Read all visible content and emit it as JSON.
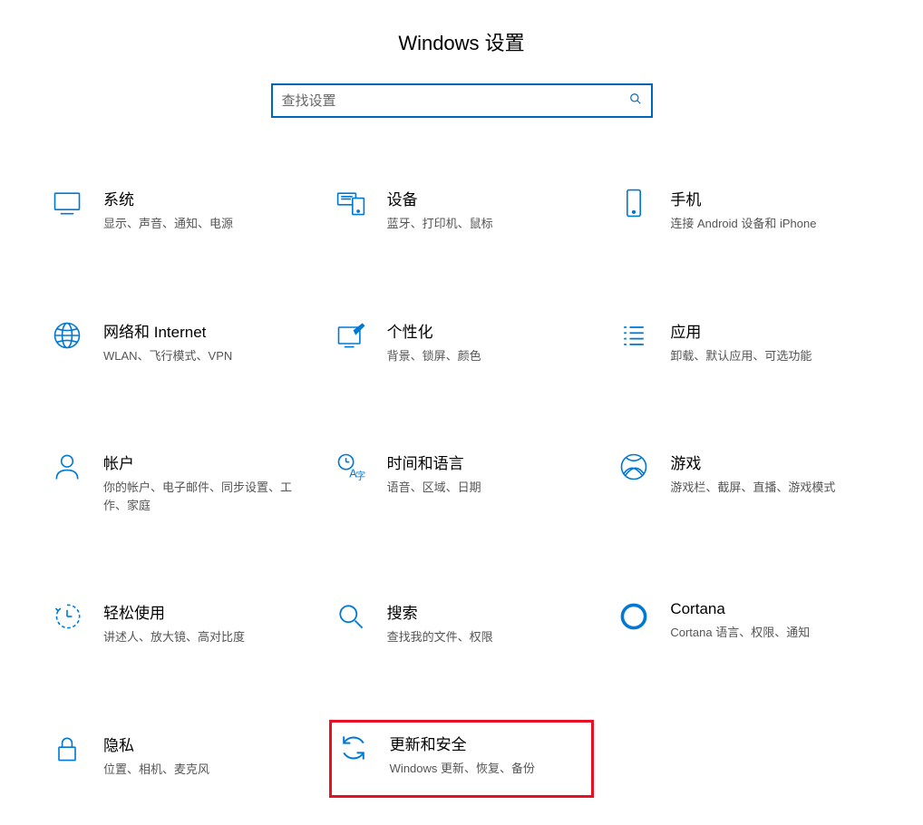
{
  "header": {
    "title": "Windows 设置"
  },
  "search": {
    "placeholder": "查找设置"
  },
  "tiles": {
    "system": {
      "title": "系统",
      "desc": "显示、声音、通知、电源"
    },
    "devices": {
      "title": "设备",
      "desc": "蓝牙、打印机、鼠标"
    },
    "phone": {
      "title": "手机",
      "desc": "连接 Android 设备和 iPhone"
    },
    "network": {
      "title": "网络和 Internet",
      "desc": "WLAN、飞行模式、VPN"
    },
    "personalization": {
      "title": "个性化",
      "desc": "背景、锁屏、颜色"
    },
    "apps": {
      "title": "应用",
      "desc": "卸载、默认应用、可选功能"
    },
    "accounts": {
      "title": "帐户",
      "desc": "你的帐户、电子邮件、同步设置、工作、家庭"
    },
    "time": {
      "title": "时间和语言",
      "desc": "语音、区域、日期"
    },
    "gaming": {
      "title": "游戏",
      "desc": "游戏栏、截屏、直播、游戏模式"
    },
    "ease": {
      "title": "轻松使用",
      "desc": "讲述人、放大镜、高对比度"
    },
    "search_tile": {
      "title": "搜索",
      "desc": "查找我的文件、权限"
    },
    "cortana": {
      "title": "Cortana",
      "desc": "Cortana 语言、权限、通知"
    },
    "privacy": {
      "title": "隐私",
      "desc": "位置、相机、麦克风"
    },
    "update": {
      "title": "更新和安全",
      "desc": "Windows 更新、恢复、备份"
    }
  }
}
